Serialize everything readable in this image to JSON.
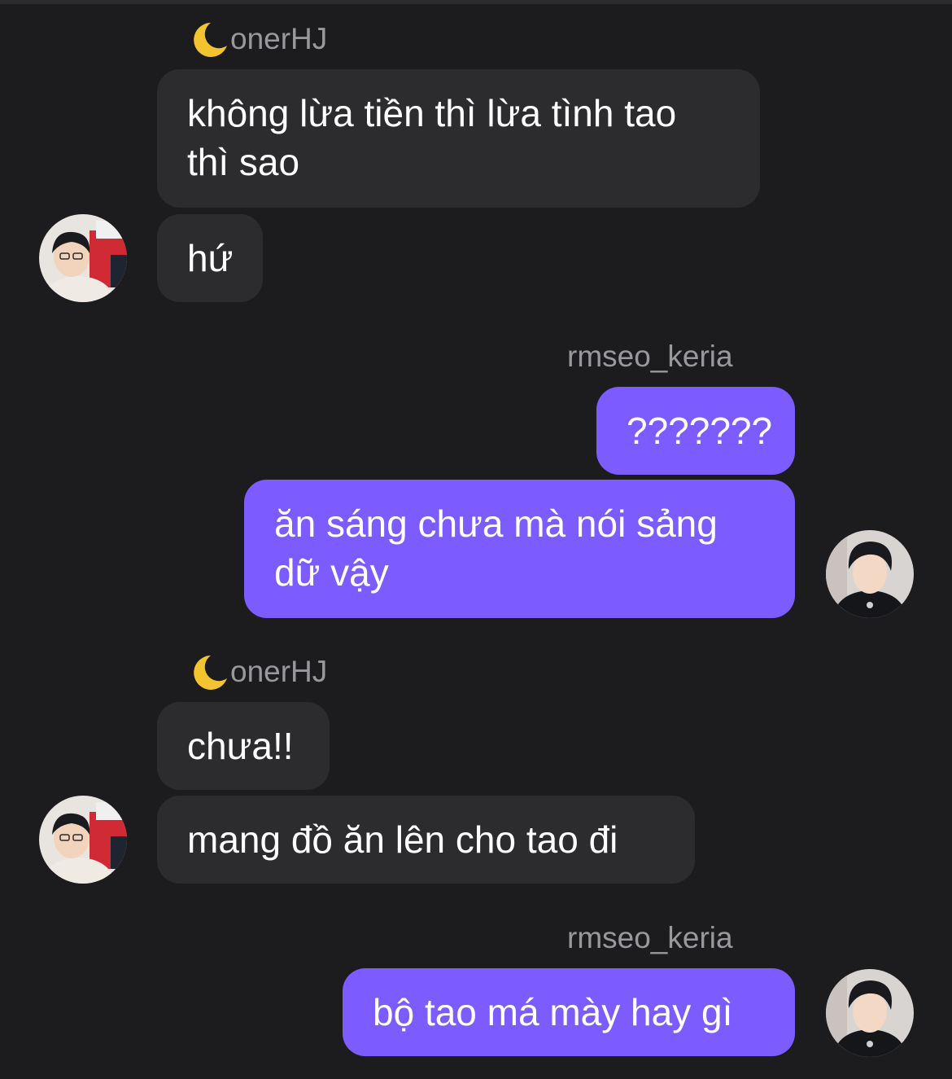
{
  "participants": {
    "them": {
      "name": "onerHJ",
      "name_icon": "crescent-moon-icon"
    },
    "me": {
      "name": "rmseo_keria"
    }
  },
  "colors": {
    "background": "#1c1c1e",
    "incoming_bubble": "#2c2c2e",
    "outgoing_bubble": "#7c5cff",
    "name_text": "#98989d"
  },
  "groups": [
    {
      "sender": "onerHJ",
      "messages": [
        {
          "text": "không lừa tiền thì lừa tình tao\nthì sao"
        },
        {
          "text": "hứ"
        }
      ]
    },
    {
      "sender": "rmseo_keria",
      "messages": [
        {
          "text": "???????"
        },
        {
          "text": "ăn sáng chưa mà nói sảng\ndữ vậy"
        }
      ]
    },
    {
      "sender": "onerHJ",
      "messages": [
        {
          "text": "chưa!!"
        },
        {
          "text": "mang đồ ăn lên cho tao đi"
        }
      ]
    },
    {
      "sender": "rmseo_keria",
      "messages": [
        {
          "text": "bộ tao má mày hay gì"
        }
      ]
    }
  ]
}
